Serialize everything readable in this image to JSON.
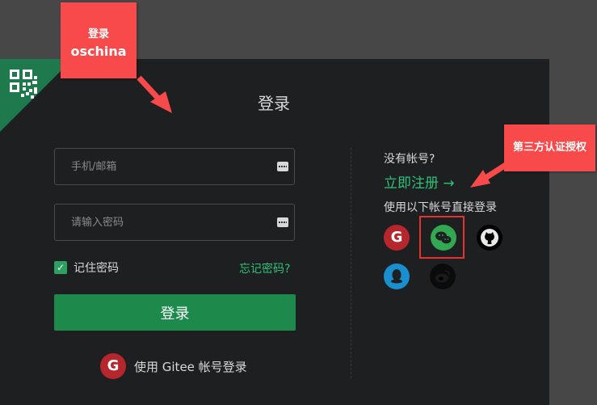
{
  "login": {
    "title": "登录",
    "phone_placeholder": "手机/邮箱",
    "password_placeholder": "请输入密码",
    "remember_label": "记住密码",
    "forgot_label": "忘记密码?",
    "login_button": "登录",
    "gitee_login_label": "使用 Gitee 帐号登录"
  },
  "side": {
    "no_account": "没有帐号?",
    "register": "立即注册 →",
    "third_party_title": "使用以下帐号直接登录",
    "providers": [
      "gitee-icon",
      "wechat-icon",
      "github-icon",
      "qq-icon",
      "weibo-icon"
    ]
  },
  "annotations": {
    "login_callout_line1": "登录",
    "login_callout_line2": "oschina",
    "third_callout": "第三方认证授权"
  },
  "colors": {
    "panel_bg": "#1e1f21",
    "page_bg": "#474747",
    "accent_green": "#1d8a4c",
    "link_green": "#2ec27a",
    "annotation_red": "#f84a4a"
  }
}
